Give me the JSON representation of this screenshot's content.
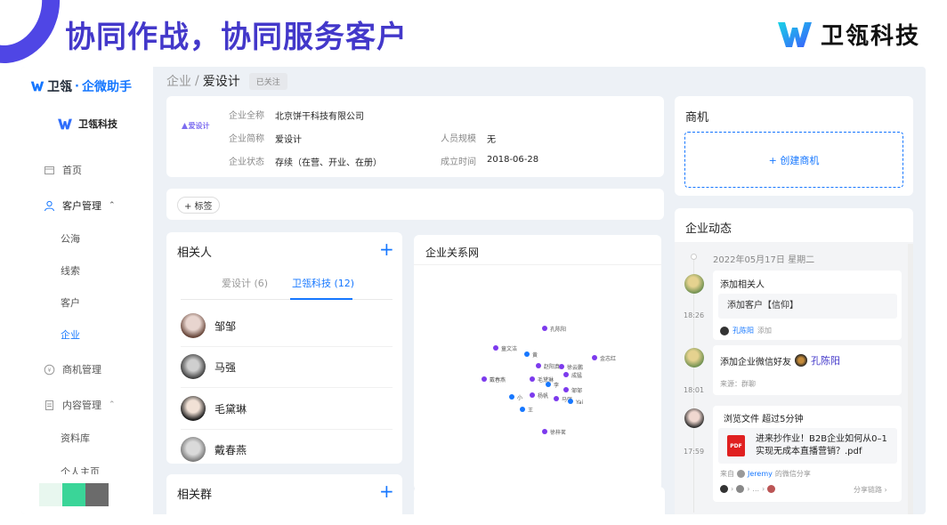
{
  "banner": {
    "title": "协同作战，协同服务客户",
    "brand_name": "卫瓴科技"
  },
  "sidebar": {
    "product_prefix": "卫瓴",
    "product_dot": "·",
    "product_suffix": "企微助手",
    "org_name": "卫瓴科技",
    "menu": {
      "home": "首页",
      "customer": "客户管理",
      "sub_public": "公海",
      "sub_leads": "线索",
      "sub_customer": "客户",
      "sub_company": "企业",
      "opportunity": "商机管理",
      "content": "内容管理",
      "sub_library": "资料库",
      "sub_partial": "个人主页"
    }
  },
  "breadcrumb": {
    "parent": "企业",
    "separator": "/",
    "current": "爱设计",
    "follow_tag": "已关注"
  },
  "company": {
    "logo_text": "爱设计",
    "full_name_label": "企业全称",
    "full_name": "北京饼干科技有限公司",
    "short_name_label": "企业简称",
    "short_name": "爱设计",
    "status_label": "企业状态",
    "status": "存续（在营、开业、在册）",
    "scale_label": "人员规模",
    "scale": "无",
    "founded_label": "成立时间",
    "founded": "2018-06-28"
  },
  "tags": {
    "add_label": "+ 标签"
  },
  "contacts": {
    "title": "相关人",
    "add_symbol": "+",
    "tab_their": "爱设计 (6)",
    "tab_ours": "卫瓴科技 (12)",
    "people": [
      "邹邹",
      "马强",
      "毛黛琳",
      "戴春燕"
    ]
  },
  "groups": {
    "title": "相关群",
    "add_symbol": "+"
  },
  "graph": {
    "title": "企业关系网",
    "nodes": [
      "孔陈阳",
      "童文洁",
      "黄",
      "赵阳真",
      "徐云鹏",
      "金志红",
      "戴春燕",
      "毛黛琳",
      "成猛",
      "李",
      "邹邹",
      "小",
      "杨帆",
      "马强",
      "Yai",
      "王",
      "徐梓茗"
    ]
  },
  "opportunities": {
    "title": "商机",
    "create_label": "+ 创建商机"
  },
  "feed": {
    "title": "企业动态",
    "date": "2022年05月17日 星期二",
    "items": [
      {
        "time": "18:26",
        "title": "添加相关人",
        "quote": "添加客户【信仰】",
        "actor": "孔陈阳",
        "action": "添加"
      },
      {
        "time": "18:01",
        "title": "添加企业微信好友",
        "target": "孔陈阳",
        "source": "来源：群聊"
      },
      {
        "time": "17:59",
        "title": "浏览文件  超过5分钟",
        "file_line1": "进来抄作业！B2B企业如何从0–1",
        "file_line2": "实现无成本直播营销？.pdf",
        "pdf_label": "PDF",
        "from_prefix": "来自",
        "from_user": "Jeremy",
        "from_suffix": "的微信分享",
        "share_link": "分享链路",
        "chain_ellipsis": "..."
      }
    ]
  }
}
